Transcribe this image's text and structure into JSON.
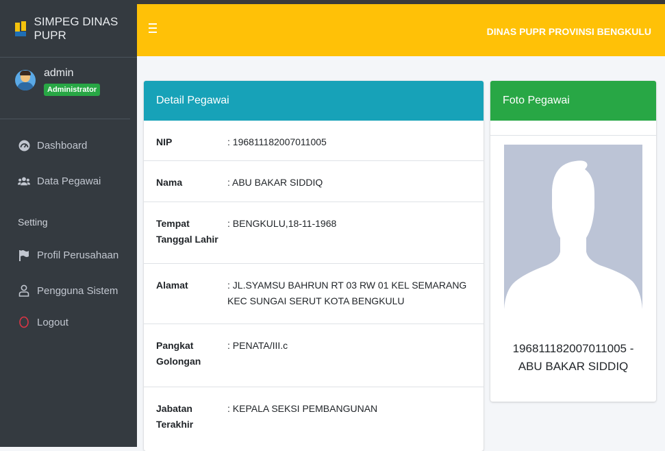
{
  "app": {
    "title": "SIMPEG DINAS PUPR"
  },
  "topbar": {
    "title": "DINAS PUPR PROVINSI BENGKULU"
  },
  "user": {
    "name": "admin",
    "role": "Administrator"
  },
  "sidebar": {
    "items": [
      {
        "label": "Dashboard",
        "icon": "dashboard-icon"
      },
      {
        "label": "Data Pegawai",
        "icon": "users-icon"
      }
    ],
    "header": "Setting",
    "setting_items": [
      {
        "label": "Profil Perusahaan",
        "icon": "flag-icon"
      },
      {
        "label": "Pengguna Sistem",
        "icon": "user-icon"
      },
      {
        "label": "Logout",
        "icon": "power-icon"
      }
    ]
  },
  "detail": {
    "title": "Detail Pegawai",
    "rows": [
      {
        "label": "NIP",
        "value": ": 196811182007011005"
      },
      {
        "label": "Nama",
        "value": ": ABU BAKAR SIDDIQ"
      },
      {
        "label": "Tempat Tanggal Lahir",
        "value": ": BENGKULU,18-11-1968"
      },
      {
        "label": "Alamat",
        "value": ": JL.SYAMSU BAHRUN RT 03 RW 01 KEL SEMARANG KEC SUNGAI SERUT KOTA BENGKULU"
      },
      {
        "label": "Pangkat Golongan",
        "value": ": PENATA/III.c"
      },
      {
        "label": "Jabatan Terakhir",
        "value": ": KEPALA SEKSI PEMBANGUNAN"
      }
    ]
  },
  "foto": {
    "title": "Foto Pegawai",
    "caption": "196811182007011005 - ABU BAKAR SIDDIQ"
  },
  "colors": {
    "topbar": "#ffc107",
    "sidebar": "#343a40",
    "detail_header": "#17a2b8",
    "foto_header": "#28a745",
    "badge": "#28a745",
    "logout_icon": "#dc3545"
  }
}
